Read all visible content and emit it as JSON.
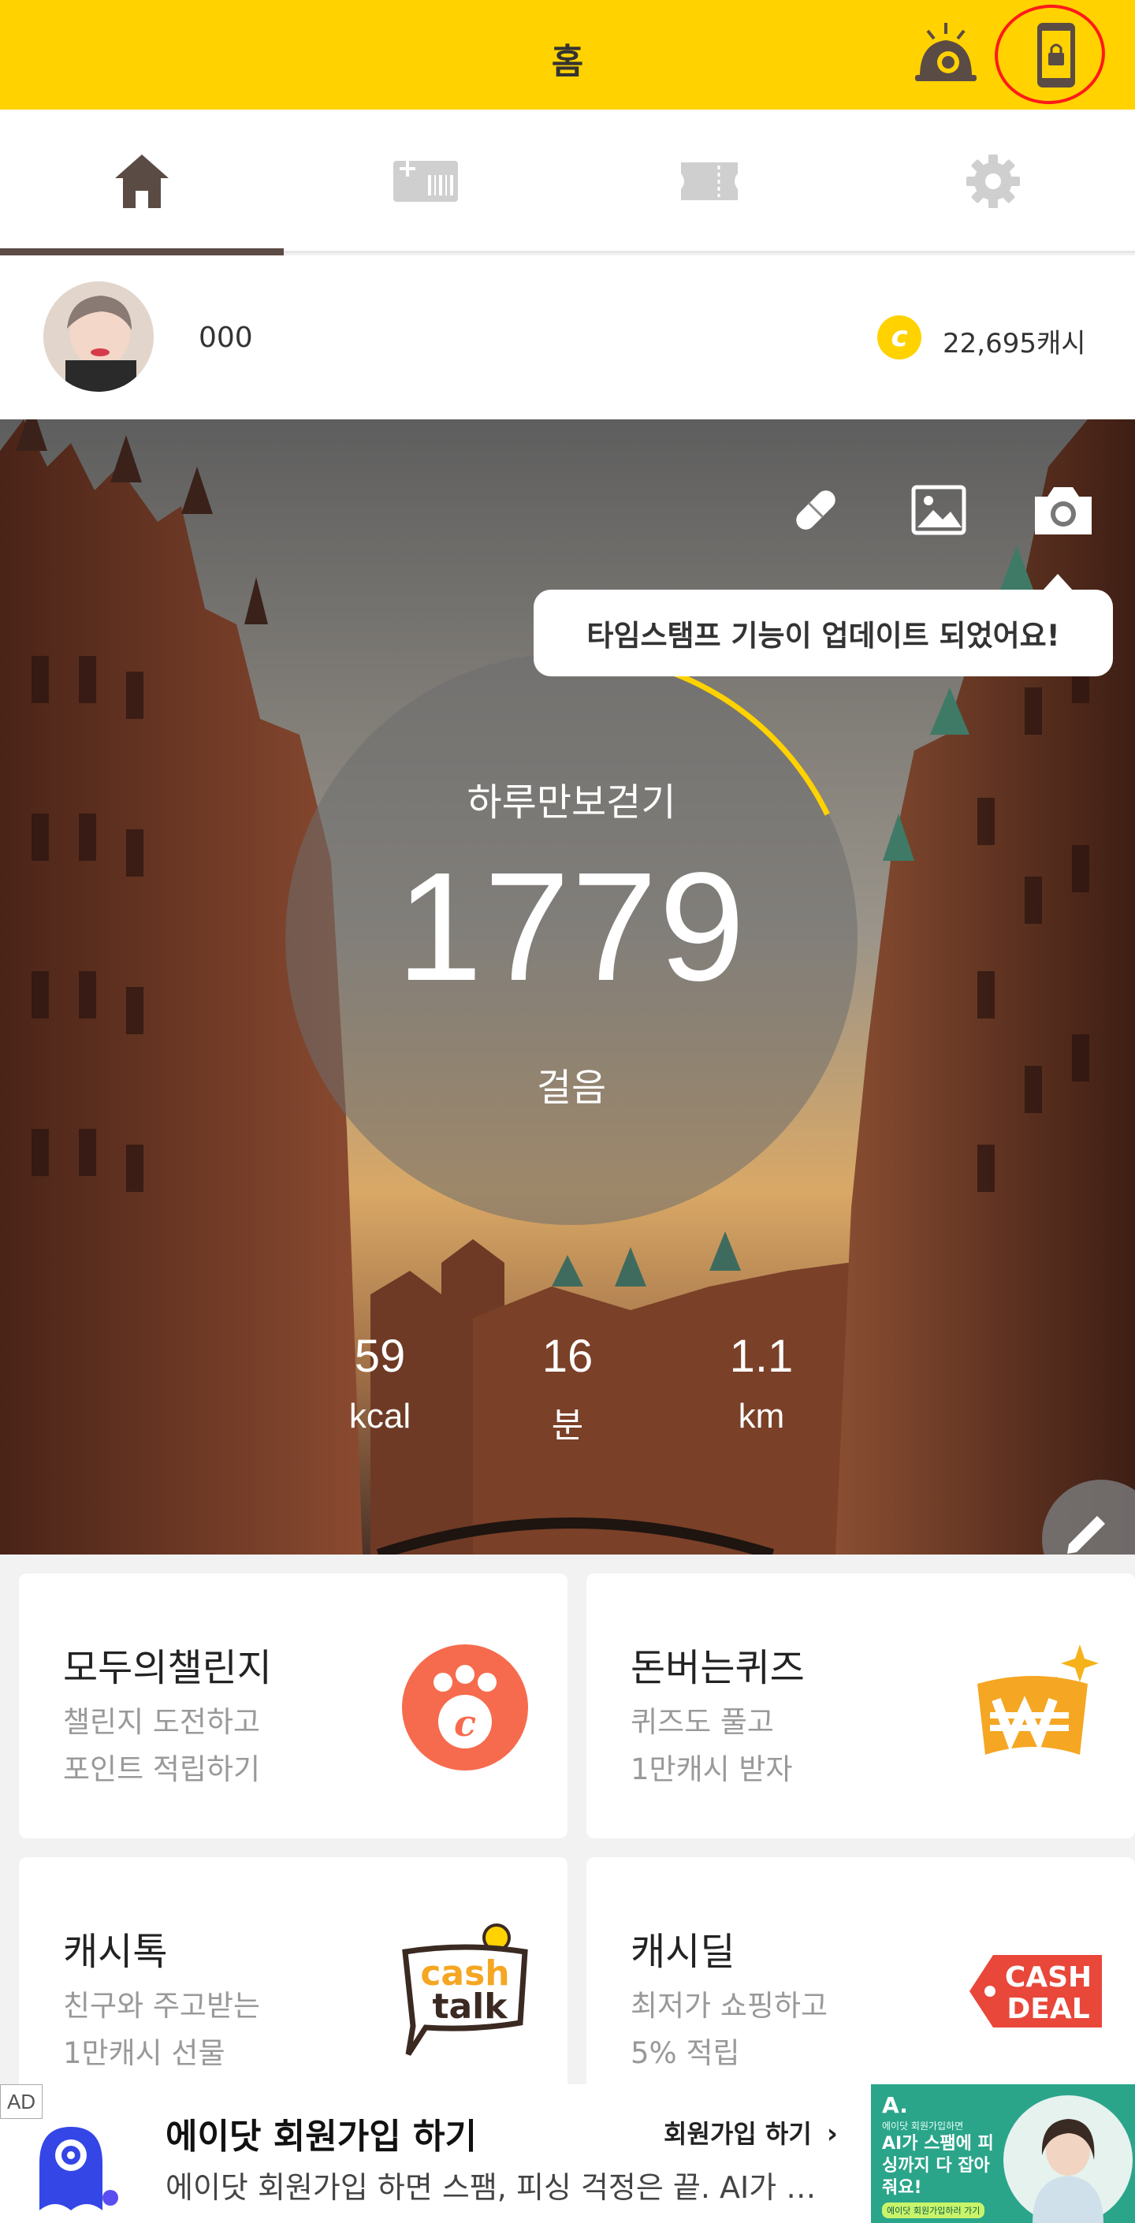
{
  "header": {
    "title": "홈"
  },
  "profile": {
    "username": "000",
    "coin_symbol": "c",
    "cash": "22,695캐시"
  },
  "tabs": [
    {
      "id": "home",
      "icon": "home-icon",
      "active": true
    },
    {
      "id": "gift",
      "icon": "gift-card-icon",
      "active": false
    },
    {
      "id": "coupon",
      "icon": "ticket-icon",
      "active": false
    },
    {
      "id": "settings",
      "icon": "gear-icon",
      "active": false
    }
  ],
  "hero": {
    "tooltip": "타임스탬프 기능이 업데이트 되었어요!",
    "dial_label": "하루만보걷기",
    "steps": "1779",
    "steps_unit": "걸음",
    "stats": [
      {
        "value": "59",
        "unit": "kcal"
      },
      {
        "value": "16",
        "unit": "분"
      },
      {
        "value": "1.1",
        "unit": "km"
      }
    ]
  },
  "cards": [
    {
      "title": "모두의챌린지",
      "desc1": "챌린지 도전하고",
      "desc2": "포인트 적립하기",
      "icon": "paw-coin-icon"
    },
    {
      "title": "돈버는퀴즈",
      "desc1": "퀴즈도 풀고",
      "desc2": "1만캐시 받자",
      "icon": "won-quiz-icon"
    },
    {
      "title": "캐시톡",
      "desc1": "친구와 주고받는",
      "desc2": "1만캐시 선물",
      "icon": "cash-talk-icon",
      "logo_line1": "cash",
      "logo_line2": "talk"
    },
    {
      "title": "캐시딜",
      "desc1": "최저가 쇼핑하고",
      "desc2": "5% 적립",
      "icon": "cash-deal-icon",
      "logo_line1": "CASH",
      "logo_line2": "DEAL"
    }
  ],
  "ad": {
    "tag": "AD",
    "title": "에이닷 회원가입 하기",
    "cta": "회원가입 하기",
    "description": "에이닷 회원가입 하면 스팸, 피싱 걱정은 끝. AI가 스팸에 피싱까지 다 잡아줘요!",
    "banner_small": "에이닷 회원가입하면",
    "banner_text": "AI가 스팸에 피싱까지 다 잡아줘요!",
    "banner_btn": "에이닷 회원가입하러 가기"
  },
  "colors": {
    "brand_yellow": "#ffd200",
    "tab_active": "#5b4b45",
    "tab_inactive": "#cfcfcf",
    "progress_arc": "#ffd200"
  },
  "step_goal_progress": 0.178
}
